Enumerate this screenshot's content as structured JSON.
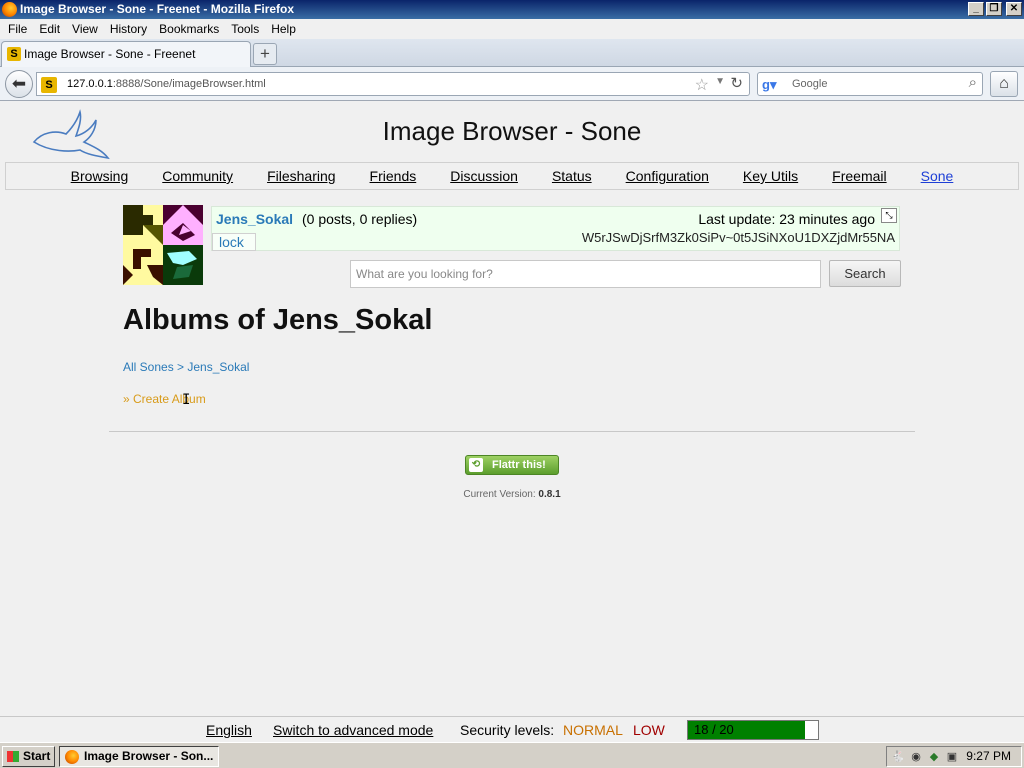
{
  "window": {
    "title": "Image Browser - Sone - Freenet - Mozilla Firefox",
    "buttons": {
      "minimize": "_",
      "maximize": "❐",
      "close": "✕"
    }
  },
  "menu": [
    "File",
    "Edit",
    "View",
    "History",
    "Bookmarks",
    "Tools",
    "Help"
  ],
  "tab": {
    "label": "Image Browser - Sone - Freenet",
    "new_tab": "+"
  },
  "address": {
    "host": "127.0.0.1",
    "rest": ":8888/Sone/imageBrowser.html"
  },
  "search_engine": {
    "placeholder": "Google"
  },
  "page": {
    "title": "Image Browser - Sone",
    "nav": [
      "Browsing",
      "Community",
      "Filesharing",
      "Friends",
      "Discussion",
      "Status",
      "Configuration",
      "Key Utils",
      "Freemail",
      "Sone"
    ],
    "nav_active": "Sone",
    "profile": {
      "name": "Jens_Sokal",
      "counts": "(0 posts, 0 replies)",
      "last_update": "Last update: 23 minutes ago",
      "lock": "lock",
      "key": "W5rJSwDjSrfM3Zk0SiPv~0t5JSiNXoU1DXZjdMr55NA"
    },
    "search": {
      "placeholder": "What are you looking for?",
      "button": "Search"
    },
    "albums_title": "Albums of Jens_Sokal",
    "breadcrumb": "All Sones > Jens_Sokal",
    "create_album": "» Create Album",
    "flattr": "Flattr this!",
    "version_label": "Current Version:",
    "version": "0.8.1"
  },
  "footer": {
    "language": "English",
    "advanced_mode": "Switch to advanced mode",
    "security_label": "Security levels:",
    "security_network": "NORMAL",
    "security_friends": "LOW",
    "peers": "18 / 20",
    "peers_fraction": 0.9
  },
  "taskbar": {
    "start": "Start",
    "task": "Image Browser - Son...",
    "clock": "9:27 PM"
  },
  "colors": {
    "link": "#2a7ab8",
    "nav_active": "#1e3fd6",
    "create_album": "#d89b1a",
    "security_normal": "#c87000",
    "security_low": "#a00000",
    "peers_bar": "#008000"
  }
}
